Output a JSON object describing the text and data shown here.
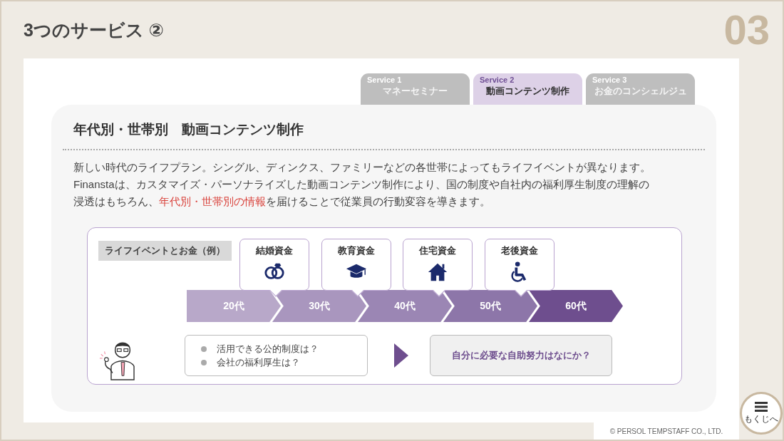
{
  "header": {
    "title": "3つのサービス ②",
    "page_number": "03"
  },
  "tabs": [
    {
      "service": "Service 1",
      "label": "マネーセミナー",
      "selected": false
    },
    {
      "service": "Service 2",
      "label": "動画コンテンツ制作",
      "selected": true
    },
    {
      "service": "Service 3",
      "label": "お金のコンシェルジュ",
      "selected": false
    }
  ],
  "card": {
    "heading": "年代別・世帯別　動画コンテンツ制作",
    "body": [
      {
        "text": "新しい時代のライフプラン。シングル、ディンクス、ファミリーなどの各世帯によってもライフイベントが異なります。Finanstaは、カスタマイズ・パーソナライズした動画コンテンツ制作により、国の制度や自社内の福利厚生制度の理解の浸透はもちろん、",
        "highlight": false
      },
      {
        "text": "年代別・世帯別の情報",
        "highlight": true
      },
      {
        "text": "を届けることで従業員の行動変容を導きます。",
        "highlight": false
      }
    ]
  },
  "diagram": {
    "label": "ライフイベントとお金（例）",
    "events": [
      {
        "label": "結婚資金",
        "kind": "rings"
      },
      {
        "label": "教育資金",
        "kind": "mortarboard"
      },
      {
        "label": "住宅資金",
        "kind": "house"
      },
      {
        "label": "老後資金",
        "kind": "wheelchair"
      }
    ],
    "ages": [
      {
        "label": "20代",
        "color": "#b8a8c9"
      },
      {
        "label": "30代",
        "color": "#a996be"
      },
      {
        "label": "40代",
        "color": "#9b86b4"
      },
      {
        "label": "50代",
        "color": "#8d76a9"
      },
      {
        "label": "60代",
        "color": "#6e4e8e"
      }
    ],
    "questions": [
      "活用できる公的制度は？",
      "会社の福利厚生は？"
    ],
    "answer": "自分に必要な自助努力はなにか？"
  },
  "footer": {
    "copyright": "© PERSOL TEMPSTAFF CO., LTD.",
    "menu_button": "もくじへ"
  }
}
